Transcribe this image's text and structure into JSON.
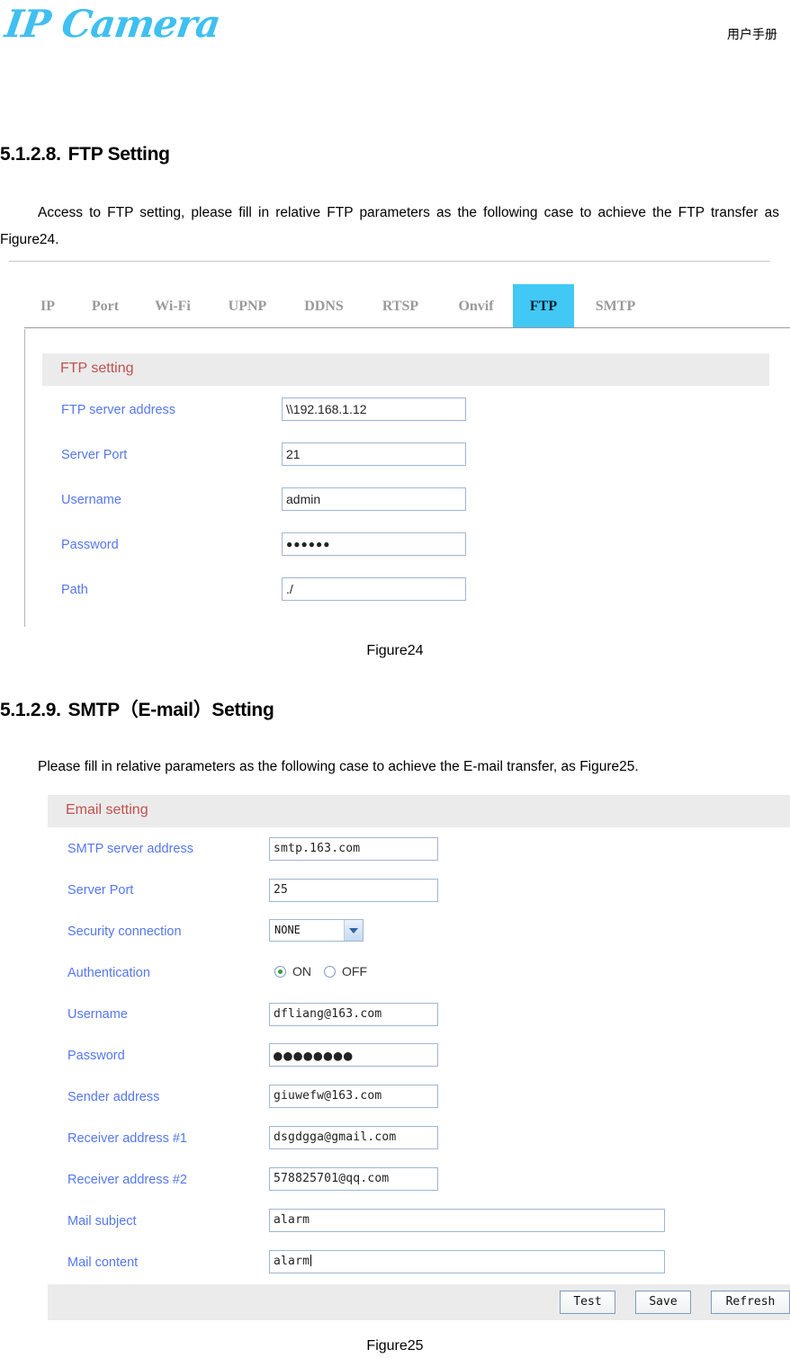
{
  "header": {
    "logo_text": "IP Camera",
    "manual_label": "用户手册"
  },
  "sections": [
    {
      "number": "5.1.2.8.",
      "title": "FTP Setting",
      "paragraph": "Access to FTP setting, please fill in relative FTP parameters as the following case to achieve the FTP transfer as Figure24.",
      "figure_caption": "Figure24"
    },
    {
      "number": "5.1.2.9.",
      "title": "SMTP（E-mail）Setting",
      "paragraph": "Please fill in relative parameters as the following case to achieve the E-mail transfer, as Figure25.",
      "figure_caption": "Figure25"
    }
  ],
  "ftp_screenshot": {
    "tabs": [
      {
        "label": "IP",
        "active": false
      },
      {
        "label": "Port",
        "active": false
      },
      {
        "label": "Wi-Fi",
        "active": false
      },
      {
        "label": "UPNP",
        "active": false
      },
      {
        "label": "DDNS",
        "active": false
      },
      {
        "label": "RTSP",
        "active": false
      },
      {
        "label": "Onvif",
        "active": false
      },
      {
        "label": "FTP",
        "active": true
      },
      {
        "label": "SMTP",
        "active": false
      }
    ],
    "active_tab_color": "#41C8F5",
    "panel_title": "FTP setting",
    "fields": [
      {
        "label": "FTP server address",
        "value": "\\\\192.168.1.12"
      },
      {
        "label": "Server Port",
        "value": "21"
      },
      {
        "label": "Username",
        "value": "admin"
      },
      {
        "label": "Password",
        "value": "●●●●●●"
      },
      {
        "label": "Path",
        "value": "./"
      }
    ]
  },
  "email_screenshot": {
    "panel_title": "Email setting",
    "fields": [
      {
        "label": "SMTP server address",
        "value": "smtp.163.com"
      },
      {
        "label": "Server Port",
        "value": "25"
      },
      {
        "label": "Security connection",
        "value": "NONE"
      },
      {
        "label": "Authentication",
        "on_label": "ON",
        "off_label": "OFF",
        "selected": "ON"
      },
      {
        "label": "Username",
        "value": "dfliang@163.com"
      },
      {
        "label": "Password",
        "value": "●●●●●●●●"
      },
      {
        "label": "Sender address",
        "value": "giuwefw@163.com"
      },
      {
        "label": "Receiver address #1",
        "value": "dsgdgga@gmail.com"
      },
      {
        "label": "Receiver address #2",
        "value": "578825701@qq.com"
      },
      {
        "label": "Mail subject",
        "value": "alarm"
      },
      {
        "label": "Mail content",
        "value": "alarm"
      }
    ],
    "buttons": [
      {
        "label": "Test"
      },
      {
        "label": "Save"
      },
      {
        "label": "Refresh"
      }
    ]
  }
}
